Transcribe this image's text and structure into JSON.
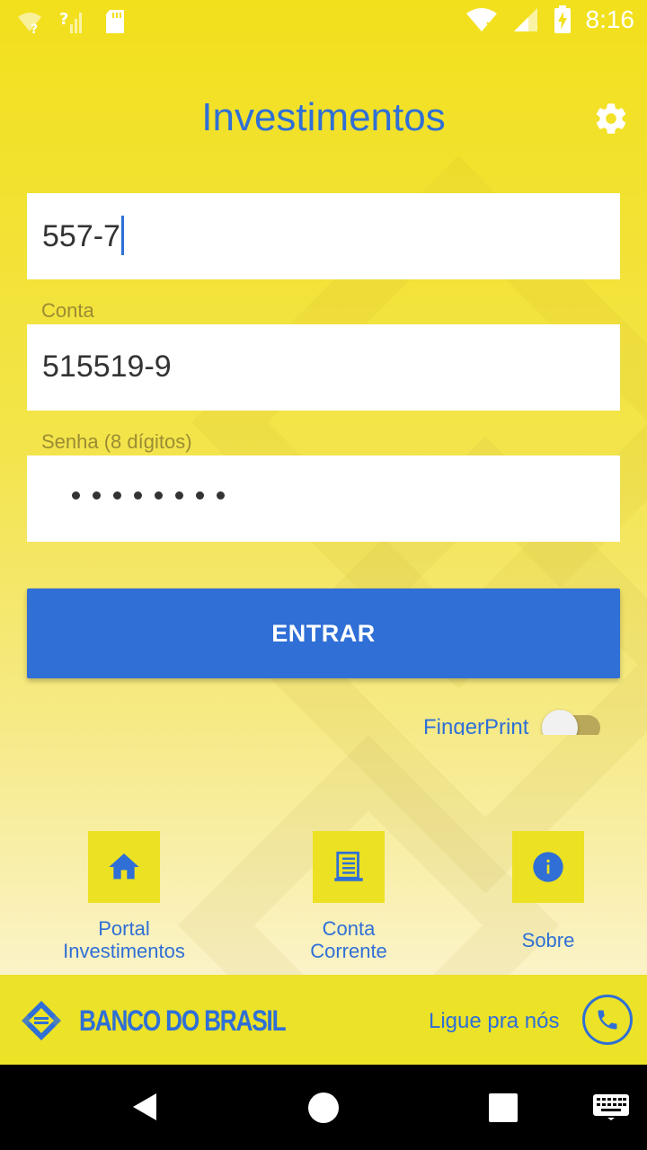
{
  "status_bar": {
    "time": "8:16",
    "icons": [
      "wifi-unknown-icon",
      "signal-unknown-icon",
      "sd-card-icon",
      "wifi-icon",
      "cell-signal-icon",
      "battery-charging-icon"
    ]
  },
  "header": {
    "title": "Investimentos",
    "settings_icon": "gear-icon"
  },
  "form": {
    "agency_value": "557-7",
    "account_label": "Conta",
    "account_value": "515519-9",
    "password_label": "Senha (8 dígitos)",
    "password_length": 8,
    "submit_label": "ENTRAR"
  },
  "fingerprint": {
    "label": "FingerPrint",
    "enabled": false
  },
  "shortcuts": [
    {
      "line1": "Portal",
      "line2": "Investimentos",
      "icon": "home-icon"
    },
    {
      "line1": "Conta",
      "line2": "Corrente",
      "icon": "receipt-icon"
    },
    {
      "line1": "Sobre",
      "line2": "",
      "icon": "info-icon"
    }
  ],
  "footer": {
    "brand": "BANCO DO BRASIL",
    "contact_label": "Ligue pra nós",
    "contact_icon": "phone-icon"
  },
  "colors": {
    "accent_blue": "#2f6fd6",
    "brand_yellow": "#f2e01c"
  }
}
